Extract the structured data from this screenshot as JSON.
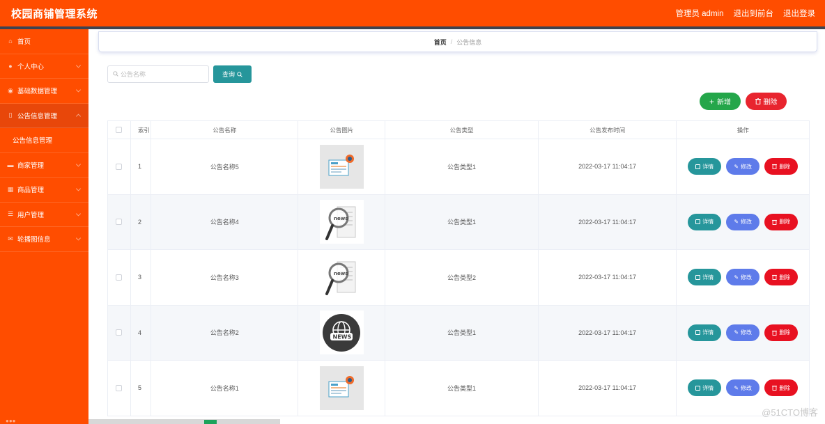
{
  "app": {
    "title": "校园商铺管理系统"
  },
  "header": {
    "user": "管理员 admin",
    "to_front": "退出到前台",
    "logout": "退出登录"
  },
  "sidebar": {
    "items": [
      {
        "label": "首页",
        "icon": "home-icon"
      },
      {
        "label": "个人中心",
        "icon": "user-icon"
      },
      {
        "label": "基础数据管理",
        "icon": "pin-icon"
      },
      {
        "label": "公告信息管理",
        "icon": "doc-icon",
        "active": true
      },
      {
        "label": "公告信息管理",
        "sub": true
      },
      {
        "label": "商家管理",
        "icon": "shop-icon"
      },
      {
        "label": "商品管理",
        "icon": "goods-icon"
      },
      {
        "label": "用户管理",
        "icon": "list-icon"
      },
      {
        "label": "轮播图信息",
        "icon": "mail-icon"
      }
    ]
  },
  "breadcrumb": {
    "home": "首页",
    "sep": "/",
    "current": "公告信息"
  },
  "search": {
    "placeholder": "公告名称",
    "query_label": "查询"
  },
  "actions": {
    "add_label": "新增",
    "delete_label": "删除"
  },
  "table": {
    "columns": [
      "索引",
      "公告名称",
      "公告图片",
      "公告类型",
      "公告发布时间",
      "操作"
    ],
    "rows": [
      {
        "index": "1",
        "name": "公告名称5",
        "image": "news-paper",
        "type": "公告类型1",
        "time": "2022-03-17 11:04:17"
      },
      {
        "index": "2",
        "name": "公告名称4",
        "image": "news-magnifier",
        "type": "公告类型1",
        "time": "2022-03-17 11:04:17"
      },
      {
        "index": "3",
        "name": "公告名称3",
        "image": "news-magnifier",
        "type": "公告类型2",
        "time": "2022-03-17 11:04:17"
      },
      {
        "index": "4",
        "name": "公告名称2",
        "image": "news-globe",
        "type": "公告类型1",
        "time": "2022-03-17 11:04:17"
      },
      {
        "index": "5",
        "name": "公告名称1",
        "image": "news-paper",
        "type": "公告类型1",
        "time": "2022-03-17 11:04:17"
      }
    ],
    "op_detail": "详情",
    "op_edit": "修改",
    "op_delete": "删除"
  },
  "watermark": "@51CTO博客",
  "colors": {
    "brand": "#ff4d00",
    "teal": "#26969b",
    "blue": "#5e7bea",
    "red": "#e81121",
    "green": "#24a64a"
  }
}
